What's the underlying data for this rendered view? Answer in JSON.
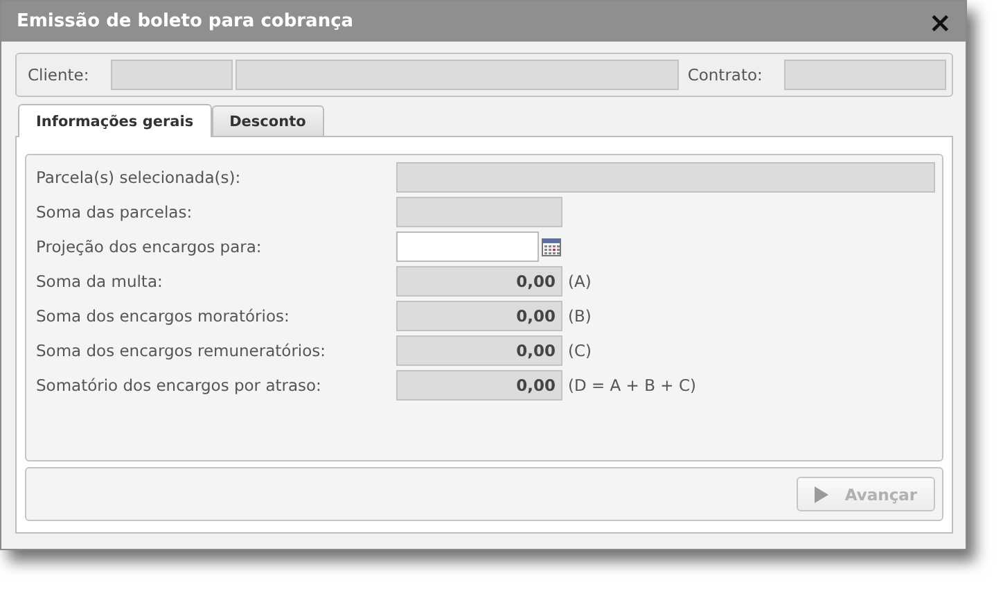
{
  "window": {
    "title": "Emissão de boleto para cobrança",
    "close": "×"
  },
  "header": {
    "client_label": "Cliente:",
    "contract_label": "Contrato:"
  },
  "tabs": [
    {
      "label": "Informações gerais",
      "selected": true
    },
    {
      "label": "Desconto",
      "selected": false
    }
  ],
  "fields": [
    {
      "label": "Parcela(s) selecionada(s):",
      "kind": "wide"
    },
    {
      "label": "Soma das parcelas:",
      "kind": "readonly"
    },
    {
      "label": "Projeção dos encargos para:",
      "kind": "date"
    },
    {
      "label": "Soma da multa:",
      "kind": "readonly",
      "value": "0,00",
      "suffix": "(A)"
    },
    {
      "label": "Soma dos encargos moratórios:",
      "kind": "readonly",
      "value": "0,00",
      "suffix": "(B)"
    },
    {
      "label": "Soma dos encargos remuneratórios:",
      "kind": "readonly",
      "value": "0,00",
      "suffix": "(C)"
    },
    {
      "label": "Somatório dos encargos por atraso:",
      "kind": "readonly",
      "value": "0,00",
      "suffix": "(D = A + B + C)"
    }
  ],
  "next_button": {
    "label": "Avançar",
    "disabled": true
  }
}
